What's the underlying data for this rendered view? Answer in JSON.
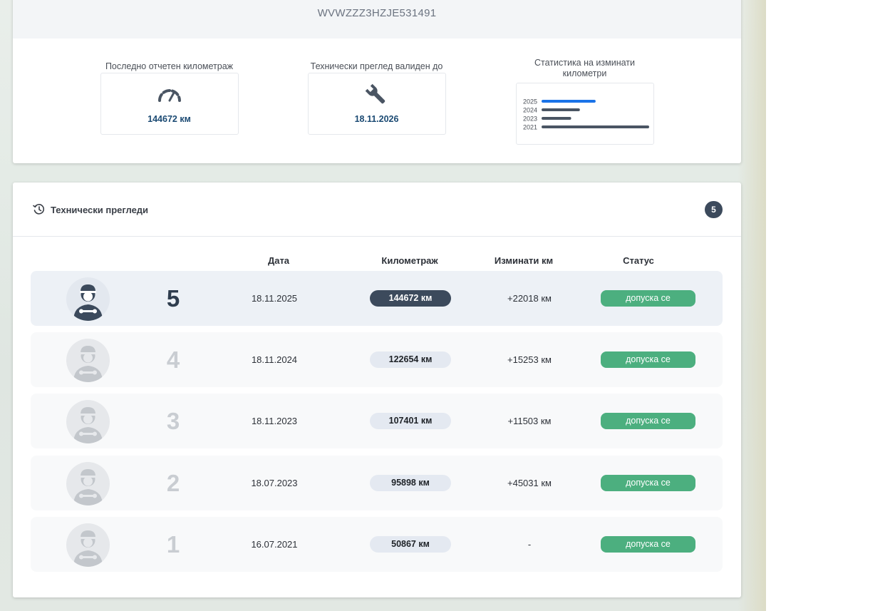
{
  "vehicle": {
    "vin": "WVWZZZ3HZJE531491"
  },
  "stats": {
    "mileage": {
      "label": "Последно отчетен километраж",
      "value": "144672 км",
      "icon": "speedometer-icon"
    },
    "inspection": {
      "label": "Технически преглед валиден до",
      "value": "18.11.2026",
      "icon": "wrench-icon"
    },
    "km_chart": {
      "label": "Статистика на изминати километри",
      "chart_data": {
        "type": "bar",
        "categories": [
          "2025",
          "2024",
          "2023",
          "2021"
        ],
        "values": [
          22018,
          15253,
          11503,
          45031
        ],
        "colors": [
          "#1a73e8",
          "#4a5563",
          "#4a5563",
          "#4a5563"
        ]
      }
    }
  },
  "history": {
    "title": "Технически прегледи",
    "count": "5",
    "columns": {
      "date": "Дата",
      "mileage": "Километраж",
      "diff": "Изминати км",
      "status": "Статус"
    },
    "rows": [
      {
        "num": "5",
        "date": "18.11.2025",
        "mileage": "144672 км",
        "diff": "+22018 км",
        "status": "допуска се"
      },
      {
        "num": "4",
        "date": "18.11.2024",
        "mileage": "122654 км",
        "diff": "+15253 км",
        "status": "допуска се"
      },
      {
        "num": "3",
        "date": "18.11.2023",
        "mileage": "107401 км",
        "diff": "+11503 км",
        "status": "допуска се"
      },
      {
        "num": "2",
        "date": "18.07.2023",
        "mileage": "95898 км",
        "diff": "+45031 км",
        "status": "допуска се"
      },
      {
        "num": "1",
        "date": "16.07.2021",
        "mileage": "50867 км",
        "diff": "-",
        "status": "допуска се"
      }
    ]
  },
  "colors": {
    "accent": "#1b4a73",
    "status_ok": "#4caf7f",
    "badge": "#3c4a5c",
    "chart_highlight": "#1a73e8"
  }
}
